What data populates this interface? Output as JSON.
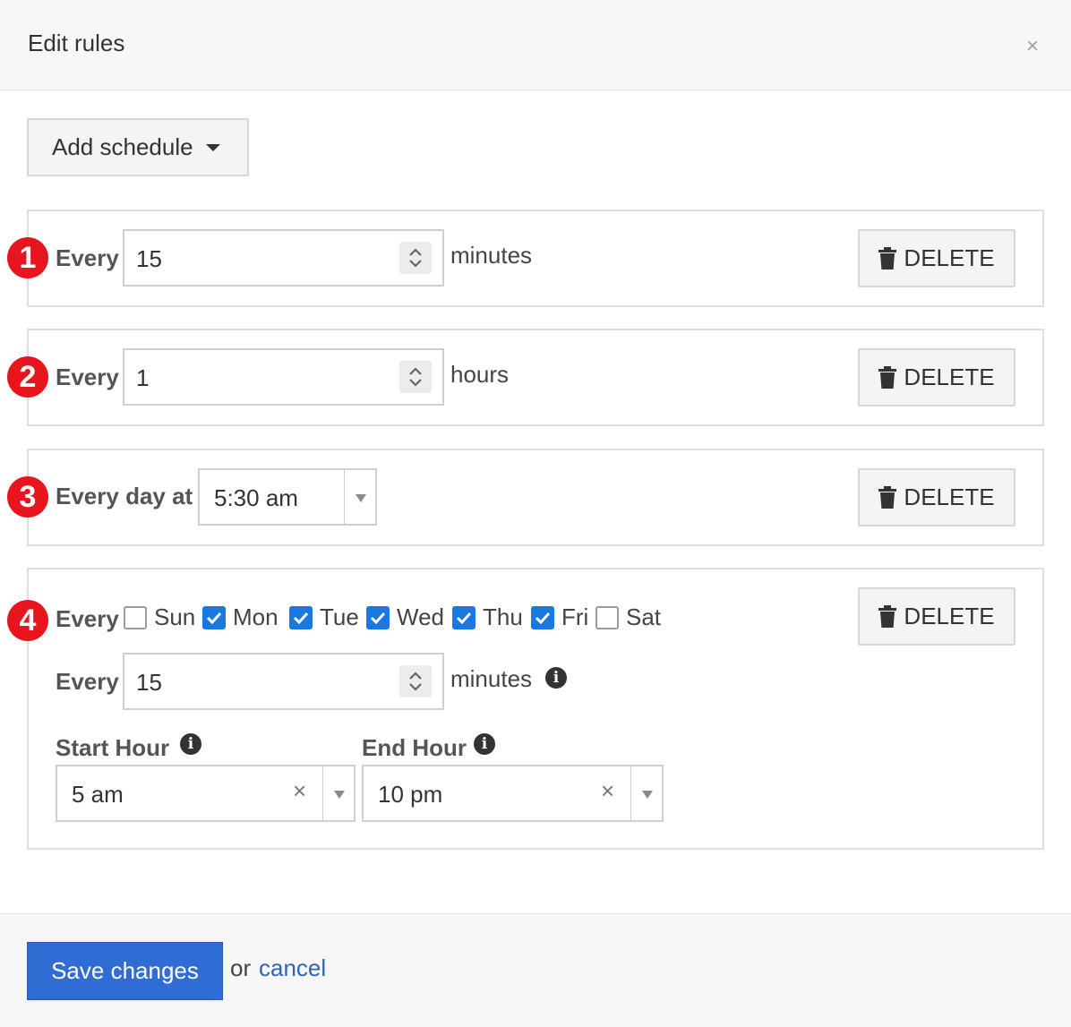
{
  "modal": {
    "title": "Edit rules",
    "close_glyph": "×"
  },
  "add_schedule": {
    "label": "Add schedule"
  },
  "rules": [
    {
      "number": "1",
      "prefix": "Every",
      "value": "15",
      "unit": "minutes",
      "delete_label": "DELETE"
    },
    {
      "number": "2",
      "prefix": "Every",
      "value": "1",
      "unit": "hours",
      "delete_label": "DELETE"
    },
    {
      "number": "3",
      "prefix": "Every day at",
      "time": "5:30 am",
      "delete_label": "DELETE"
    },
    {
      "number": "4",
      "prefix": "Every",
      "days": [
        {
          "label": "Sun",
          "checked": false
        },
        {
          "label": "Mon",
          "checked": true
        },
        {
          "label": "Tue",
          "checked": true
        },
        {
          "label": "Wed",
          "checked": true
        },
        {
          "label": "Thu",
          "checked": true
        },
        {
          "label": "Fri",
          "checked": true
        },
        {
          "label": "Sat",
          "checked": false
        }
      ],
      "interval_prefix": "Every",
      "interval_value": "15",
      "interval_unit": "minutes",
      "start_hour_label": "Start Hour",
      "start_hour_value": "5 am",
      "end_hour_label": "End Hour",
      "end_hour_value": "10 pm",
      "clear_glyph": "×",
      "info_glyph": "i",
      "delete_label": "DELETE"
    }
  ],
  "footer": {
    "save_label": "Save changes",
    "or_text": "or",
    "cancel_label": "cancel"
  },
  "colors": {
    "badge": "#e8141e",
    "primary": "#2f6cd3",
    "checkbox": "#1a78e0",
    "link": "#2e63b8"
  },
  "icons": {
    "trash": "trash-icon",
    "info": "info-icon",
    "close": "close-icon",
    "caret": "caret-down-icon"
  }
}
